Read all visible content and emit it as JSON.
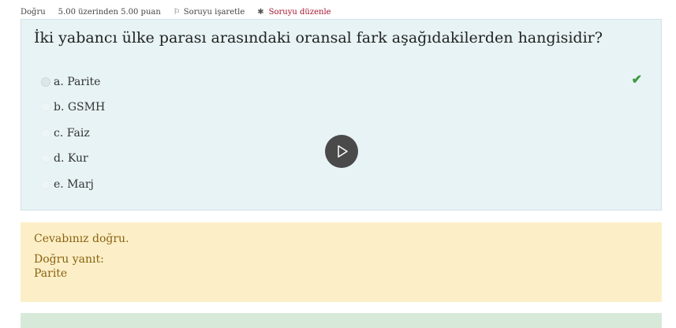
{
  "info": {
    "state": "Doğru",
    "grade": "5.00 üzerinden 5.00 puan",
    "flag_label": "Soruyu işaretle",
    "edit_label": "Soruyu düzenle",
    "edit_color": "#a3102c"
  },
  "question": {
    "text": "İki yabancı ülke parası arasındaki oransal fark aşağıdakilerden hangisidir?",
    "answers": [
      {
        "label": "a. Parite",
        "selected": true,
        "correct": true
      },
      {
        "label": "b. GSMH",
        "selected": false
      },
      {
        "label": "c. Faiz",
        "selected": false
      },
      {
        "label": "d. Kur",
        "selected": false
      },
      {
        "label": "e. Marj",
        "selected": false
      }
    ],
    "correct_icon": "check-icon",
    "background": "#e7f3f5"
  },
  "feedback": {
    "message": "Cevabınız doğru.",
    "right_answer_label": "Doğru yanıt:",
    "right_answer": "Parite",
    "background": "#fcefc7"
  },
  "video": {
    "icon": "play-icon"
  }
}
